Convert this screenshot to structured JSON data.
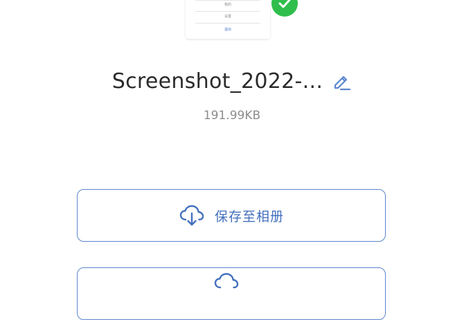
{
  "preview": {
    "lines": [
      "我的",
      "设置",
      "退出"
    ]
  },
  "file": {
    "name": "Screenshot_2022-...",
    "size": "191.99KB"
  },
  "actions": {
    "save_label": "保存至相册",
    "save_icon": "cloud-download-icon",
    "second_icon": "cloud-icon"
  },
  "colors": {
    "accent": "#4470bd",
    "border": "#5b86cf",
    "success": "#2fbe4c"
  }
}
